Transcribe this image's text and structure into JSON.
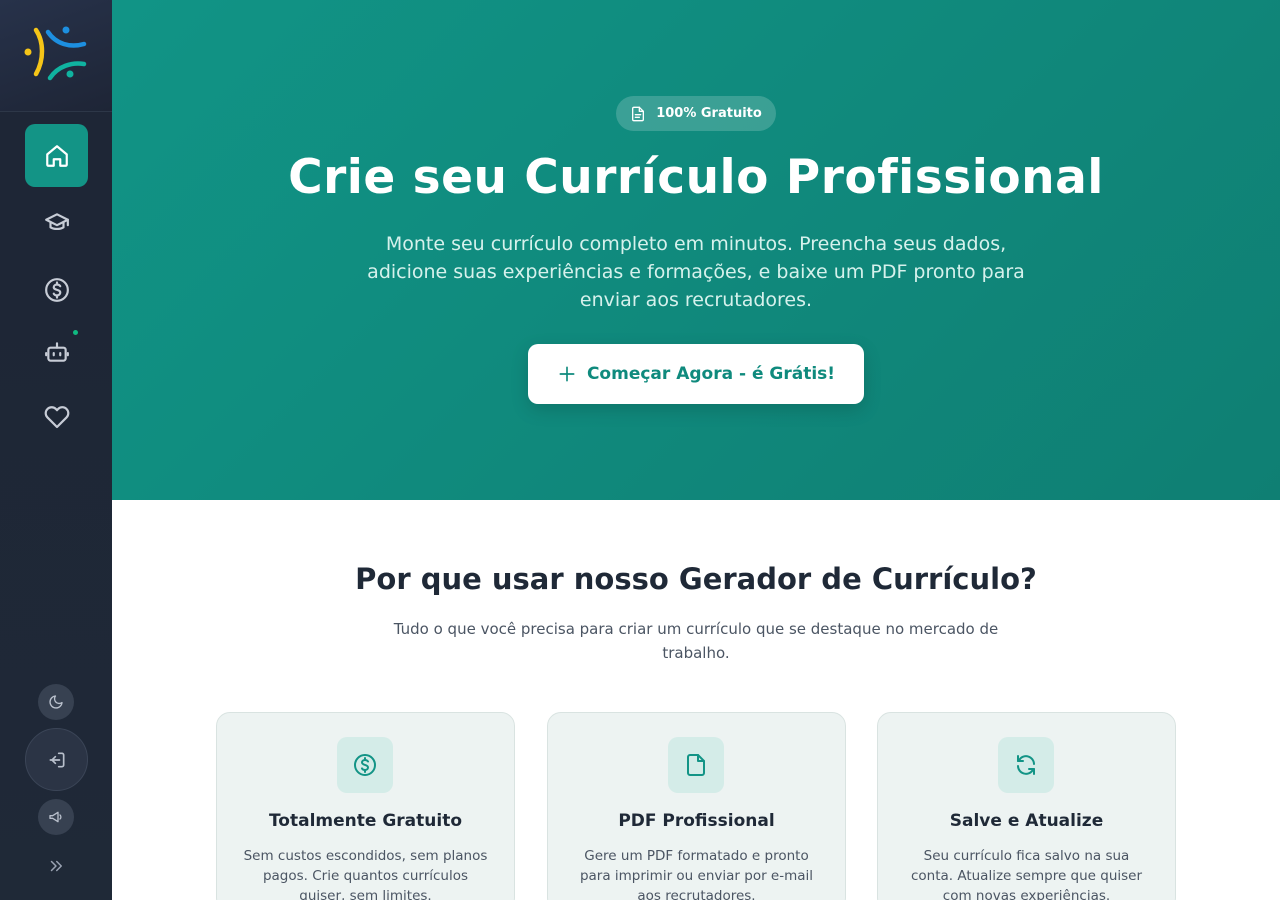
{
  "brand": {
    "colors": {
      "primary": "#139486",
      "sidebar": "#1f2937",
      "logo_blue": "#1d8fe0",
      "logo_yellow": "#f5c518",
      "logo_teal": "#10b3a0"
    }
  },
  "sidebar": {
    "items": [
      {
        "name": "home",
        "icon": "home-icon",
        "active": true
      },
      {
        "name": "courses",
        "icon": "graduation-cap-icon",
        "active": false
      },
      {
        "name": "finance",
        "icon": "dollar-circle-icon",
        "active": false
      },
      {
        "name": "ai-assistant",
        "icon": "robot-icon",
        "active": false,
        "indicator": true
      },
      {
        "name": "favorites",
        "icon": "heart-icon",
        "active": false
      }
    ],
    "utilities": [
      "moon-icon",
      "logout-icon",
      "megaphone-icon",
      "chevrons-right-icon"
    ]
  },
  "hero": {
    "badge": "100% Gratuito",
    "title": "Crie seu Currículo Profissional",
    "subtitle": "Monte seu currículo completo em minutos. Preencha seus dados, adicione suas experiências e formações, e baixe um PDF pronto para enviar aos recrutadores.",
    "cta": "Começar Agora - é Grátis!"
  },
  "why": {
    "title": "Por que usar nosso Gerador de Currículo?",
    "subtitle": "Tudo o que você precisa para criar um currículo que se destaque no mercado de trabalho.",
    "cards": [
      {
        "icon": "dollar-circle-icon",
        "title": "Totalmente Gratuito",
        "text": "Sem custos escondidos, sem planos pagos. Crie quantos currículos quiser, sem limites."
      },
      {
        "icon": "document-icon",
        "title": "PDF Profissional",
        "text": "Gere um PDF formatado e pronto para imprimir ou enviar por e-mail aos recrutadores."
      },
      {
        "icon": "refresh-icon",
        "title": "Salve e Atualize",
        "text": "Seu currículo fica salvo na sua conta. Atualize sempre que quiser com novas experiências."
      }
    ]
  }
}
